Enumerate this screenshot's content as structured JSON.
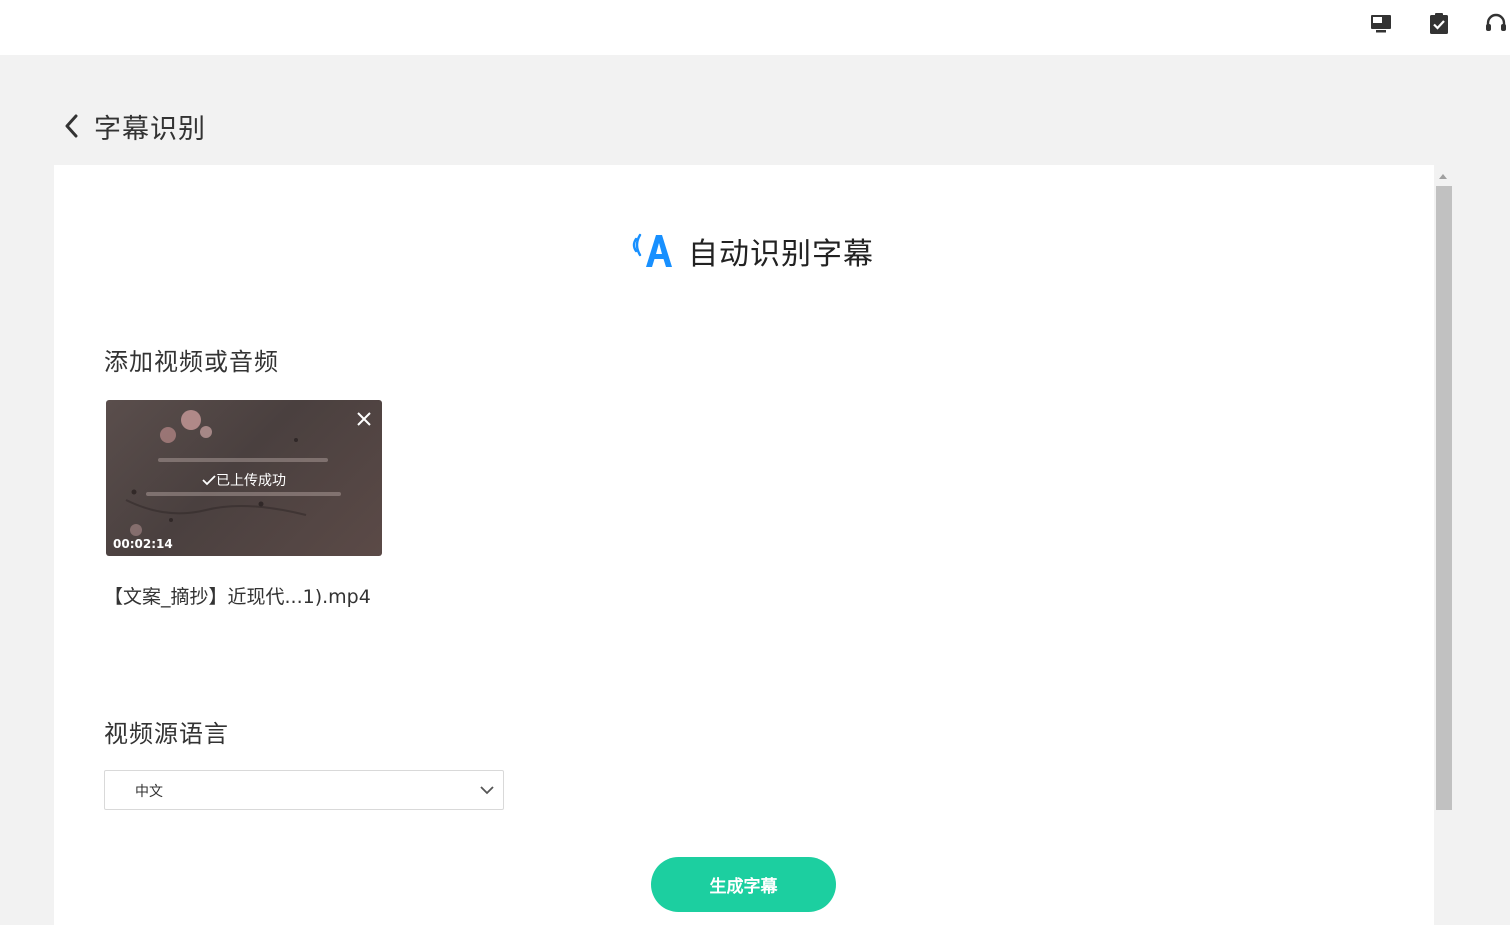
{
  "header": {
    "icons": [
      "monitor-icon",
      "clipboard-check-icon",
      "headset-icon"
    ]
  },
  "page": {
    "title": "字幕识别",
    "back_icon": "chevron-left-icon"
  },
  "hero": {
    "title": "自动识别字幕",
    "icon": "voice-a-icon",
    "accent": "#1890ff"
  },
  "upload": {
    "section_label": "添加视频或音频",
    "status": "已上传成功",
    "duration": "00:02:14",
    "filename": "【文案_摘抄】近现代...1).mp4"
  },
  "language": {
    "section_label": "视频源语言",
    "selected": "中文"
  },
  "actions": {
    "generate_label": "生成字幕",
    "generate_color": "#1ccfa0"
  }
}
